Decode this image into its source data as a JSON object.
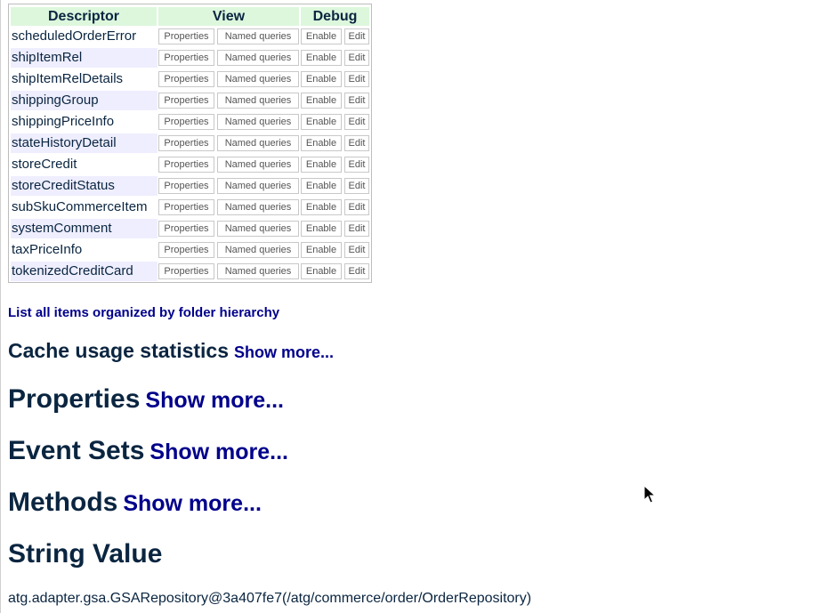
{
  "table": {
    "headers": {
      "descriptor": "Descriptor",
      "view": "View",
      "debug": "Debug"
    },
    "buttons": {
      "properties": "Properties",
      "named_queries": "Named queries",
      "enable": "Enable",
      "edit": "Edit"
    },
    "rows": [
      "scheduledOrderError",
      "shipItemRel",
      "shipItemRelDetails",
      "shippingGroup",
      "shippingPriceInfo",
      "stateHistoryDetail",
      "storeCredit",
      "storeCreditStatus",
      "subSkuCommerceItem",
      "systemComment",
      "taxPriceInfo",
      "tokenizedCreditCard"
    ]
  },
  "links": {
    "list_all": "List all items organized by folder hierarchy"
  },
  "sections": {
    "cache": {
      "title": "Cache usage statistics",
      "more": "Show more..."
    },
    "properties": {
      "title": "Properties",
      "more": "Show more..."
    },
    "event_sets": {
      "title": "Event Sets",
      "more": "Show more..."
    },
    "methods": {
      "title": "Methods",
      "more": "Show more..."
    },
    "string_value": {
      "title": "String Value"
    }
  },
  "string_value": "atg.adapter.gsa.GSARepository@3a407fe7(/atg/commerce/order/OrderRepository)",
  "colors": {
    "header_bg": "#ddf7dd",
    "alt_row_bg": "#eeeeff",
    "link": "#00008b",
    "text": "#0a2540"
  },
  "icons": {
    "cursor": "mouse-pointer-icon"
  }
}
